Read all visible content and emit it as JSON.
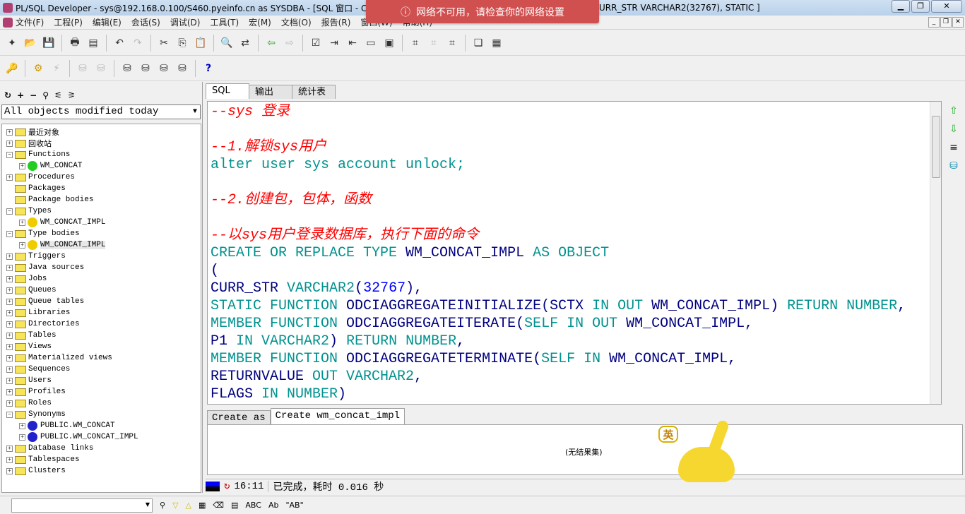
{
  "window": {
    "title": "PL/SQL Developer - sys@192.168.0.100/S460.pyeinfo.cn as SYSDBA - [SQL 窗口 - CREA",
    "title_tail": "URR_STR VARCHAR2(32767), STATIC ]"
  },
  "toast": {
    "message": "网络不可用，请检查你的网络设置"
  },
  "menu": [
    "文件(F)",
    "工程(P)",
    "编辑(E)",
    "会话(S)",
    "调试(D)",
    "工具(T)",
    "宏(M)",
    "文档(O)",
    "报告(R)",
    "窗口(W)",
    "帮助(H)"
  ],
  "left": {
    "filter": "All objects modified today",
    "tree": [
      {
        "label": "最近对象",
        "level": 0,
        "exp": "+",
        "icon": "folder"
      },
      {
        "label": "回收站",
        "level": 0,
        "exp": "+",
        "icon": "folder"
      },
      {
        "label": "Functions",
        "level": 0,
        "exp": "-",
        "icon": "folder"
      },
      {
        "label": "WM_CONCAT",
        "level": 1,
        "exp": "+",
        "icon": "function"
      },
      {
        "label": "Procedures",
        "level": 0,
        "exp": "+",
        "icon": "folder"
      },
      {
        "label": "Packages",
        "level": 0,
        "exp": "",
        "icon": "folder"
      },
      {
        "label": "Package bodies",
        "level": 0,
        "exp": "",
        "icon": "folder"
      },
      {
        "label": "Types",
        "level": 0,
        "exp": "-",
        "icon": "folder"
      },
      {
        "label": "WM_CONCAT_IMPL",
        "level": 1,
        "exp": "+",
        "icon": "type"
      },
      {
        "label": "Type bodies",
        "level": 0,
        "exp": "-",
        "icon": "folder"
      },
      {
        "label": "WM_CONCAT_IMPL",
        "level": 1,
        "exp": "+",
        "icon": "typebody"
      },
      {
        "label": "Triggers",
        "level": 0,
        "exp": "+",
        "icon": "folder"
      },
      {
        "label": "Java sources",
        "level": 0,
        "exp": "+",
        "icon": "folder"
      },
      {
        "label": "Jobs",
        "level": 0,
        "exp": "+",
        "icon": "folder"
      },
      {
        "label": "Queues",
        "level": 0,
        "exp": "+",
        "icon": "folder"
      },
      {
        "label": "Queue tables",
        "level": 0,
        "exp": "+",
        "icon": "folder"
      },
      {
        "label": "Libraries",
        "level": 0,
        "exp": "+",
        "icon": "folder"
      },
      {
        "label": "Directories",
        "level": 0,
        "exp": "+",
        "icon": "folder"
      },
      {
        "label": "Tables",
        "level": 0,
        "exp": "+",
        "icon": "folder"
      },
      {
        "label": "Views",
        "level": 0,
        "exp": "+",
        "icon": "folder"
      },
      {
        "label": "Materialized views",
        "level": 0,
        "exp": "+",
        "icon": "folder"
      },
      {
        "label": "Sequences",
        "level": 0,
        "exp": "+",
        "icon": "folder"
      },
      {
        "label": "Users",
        "level": 0,
        "exp": "+",
        "icon": "folder"
      },
      {
        "label": "Profiles",
        "level": 0,
        "exp": "+",
        "icon": "folder"
      },
      {
        "label": "Roles",
        "level": 0,
        "exp": "+",
        "icon": "folder"
      },
      {
        "label": "Synonyms",
        "level": 0,
        "exp": "-",
        "icon": "folder"
      },
      {
        "label": "PUBLIC.WM_CONCAT",
        "level": 1,
        "exp": "+",
        "icon": "synonym"
      },
      {
        "label": "PUBLIC.WM_CONCAT_IMPL",
        "level": 1,
        "exp": "+",
        "icon": "synonym"
      },
      {
        "label": "Database links",
        "level": 0,
        "exp": "+",
        "icon": "folder"
      },
      {
        "label": "Tablespaces",
        "level": 0,
        "exp": "+",
        "icon": "folder"
      },
      {
        "label": "Clusters",
        "level": 0,
        "exp": "+",
        "icon": "folder"
      }
    ]
  },
  "editor": {
    "tabs": [
      "SQL",
      "输出",
      "统计表"
    ],
    "code": [
      [
        [
          "--sys 登录",
          "comment"
        ]
      ],
      [],
      [
        [
          "--1.解锁sys用户",
          "comment"
        ]
      ],
      [
        [
          "alter user sys account unlock;",
          "kw"
        ]
      ],
      [],
      [
        [
          "--2.创建包，包体，函数",
          "comment"
        ]
      ],
      [],
      [
        [
          "--以sys用户登录数据库，执行下面的命令",
          "comment"
        ]
      ],
      [
        [
          "CREATE OR REPLACE TYPE ",
          "kw"
        ],
        [
          "WM_CONCAT_IMPL",
          "id"
        ],
        [
          " AS OBJECT",
          "kw"
        ]
      ],
      [
        [
          "(",
          "id"
        ]
      ],
      [
        [
          "CURR_STR ",
          "id"
        ],
        [
          "VARCHAR2",
          "kw"
        ],
        [
          "(",
          "id"
        ],
        [
          "32767",
          "num"
        ],
        [
          "),",
          "id"
        ]
      ],
      [
        [
          "STATIC FUNCTION ",
          "kw"
        ],
        [
          "ODCIAGGREGATEINITIALIZE",
          "id"
        ],
        [
          "(SCTX ",
          "id"
        ],
        [
          "IN OUT ",
          "kw"
        ],
        [
          "WM_CONCAT_IMPL",
          "id"
        ],
        [
          ") ",
          "id"
        ],
        [
          "RETURN NUMBER",
          "kw"
        ],
        [
          ",",
          "id"
        ]
      ],
      [
        [
          "MEMBER FUNCTION ",
          "kw"
        ],
        [
          "ODCIAGGREGATEITERATE",
          "id"
        ],
        [
          "(",
          "id"
        ],
        [
          "SELF IN OUT ",
          "kw"
        ],
        [
          "WM_CONCAT_IMPL",
          "id"
        ],
        [
          ",",
          "id"
        ]
      ],
      [
        [
          "P1 ",
          "id"
        ],
        [
          "IN VARCHAR2",
          "kw"
        ],
        [
          ") ",
          "id"
        ],
        [
          "RETURN NUMBER",
          "kw"
        ],
        [
          ",",
          "id"
        ]
      ],
      [
        [
          "MEMBER FUNCTION ",
          "kw"
        ],
        [
          "ODCIAGGREGATETERMINATE",
          "id"
        ],
        [
          "(",
          "id"
        ],
        [
          "SELF IN ",
          "kw"
        ],
        [
          "WM_CONCAT_IMPL",
          "id"
        ],
        [
          ",",
          "id"
        ]
      ],
      [
        [
          "RETURNVALUE ",
          "id"
        ],
        [
          "OUT VARCHAR2",
          "kw"
        ],
        [
          ",",
          "id"
        ]
      ],
      [
        [
          "FLAGS ",
          "id"
        ],
        [
          "IN NUMBER",
          "kw"
        ],
        [
          ")",
          "id"
        ]
      ]
    ]
  },
  "results": {
    "tabs": [
      "Create as",
      "Create wm_concat_impl"
    ],
    "empty": "(无结果集)"
  },
  "status": {
    "time": "16:11",
    "message": "已完成，耗时 0.016 秒"
  },
  "mascot_text": "英",
  "colors": {
    "comment": "#ff0000",
    "keyword": "#00928f",
    "identifier": "#000080",
    "number": "#0000ff",
    "toast": "#d05050"
  }
}
